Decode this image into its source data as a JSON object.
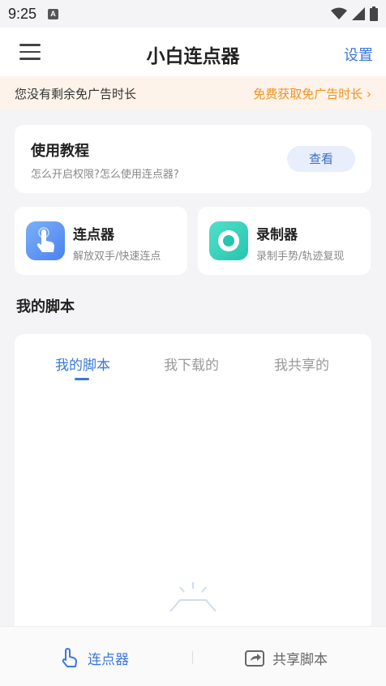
{
  "status_bar": {
    "time": "9:25",
    "notification_icon": "A",
    "icons": [
      "wifi-icon",
      "signal-icon",
      "battery-icon"
    ]
  },
  "app_bar": {
    "title": "小白连点器",
    "settings_label": "设置",
    "menu_icon": "hamburger-menu-icon"
  },
  "ad_banner": {
    "text": "您没有剩余免广告时长",
    "link": "免费获取免广告时长 ›"
  },
  "tutorial": {
    "title": "使用教程",
    "subtitle": "怎么开启权限?怎么使用连点器?",
    "button": "查看"
  },
  "features": [
    {
      "title": "连点器",
      "subtitle": "解放双手/快速连点",
      "icon": "tap-hand-icon",
      "color": "#4a82ee"
    },
    {
      "title": "录制器",
      "subtitle": "录制手势/轨迹复现",
      "icon": "record-icon",
      "color": "#27c4b0"
    }
  ],
  "section": {
    "title": "我的脚本"
  },
  "script_tabs": [
    {
      "label": "我的脚本",
      "active": true
    },
    {
      "label": "我下载的",
      "active": false
    },
    {
      "label": "我共享的",
      "active": false
    }
  ],
  "bottom_nav": [
    {
      "label": "连点器",
      "icon": "tap-hand-icon",
      "active": true
    },
    {
      "label": "共享脚本",
      "icon": "share-icon",
      "active": false
    }
  ],
  "colors": {
    "accent": "#3a78d8",
    "ad_link": "#f39220",
    "ad_background": "#fdf3ea"
  }
}
